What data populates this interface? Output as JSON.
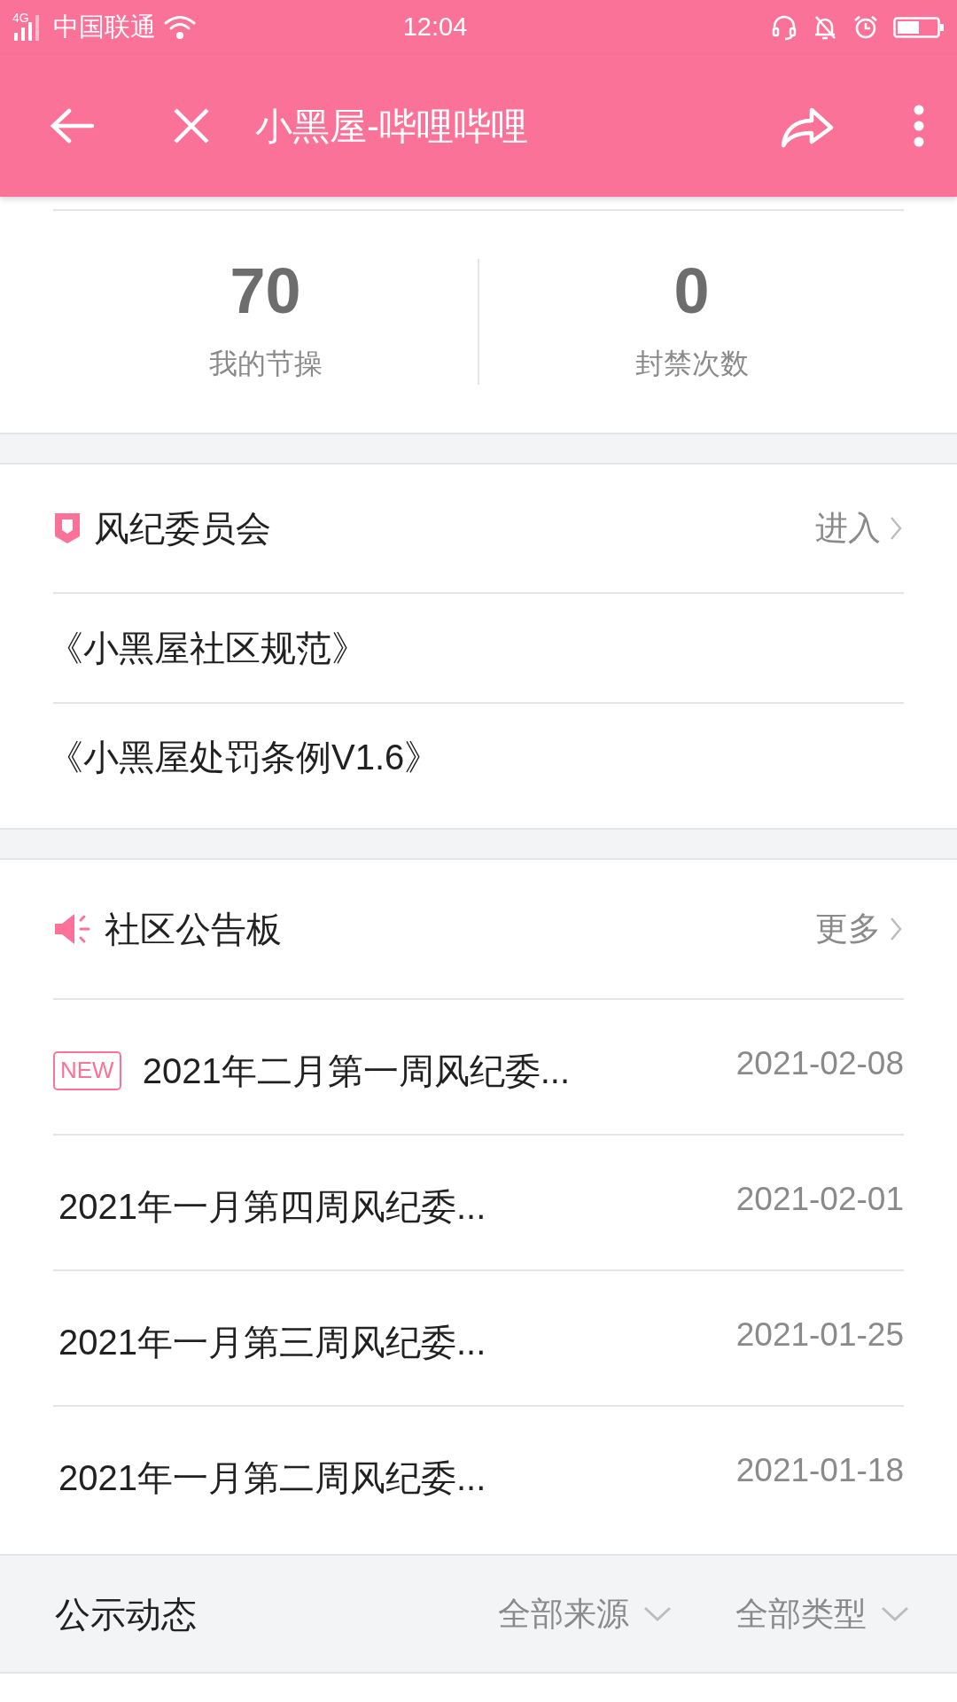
{
  "status_bar": {
    "network": "4G",
    "carrier": "中国联通",
    "time": "12:04"
  },
  "toolbar": {
    "title": "小黑屋-哔哩哔哩"
  },
  "stats": [
    {
      "value": "70",
      "label": "我的节操"
    },
    {
      "value": "0",
      "label": "封禁次数"
    }
  ],
  "committee": {
    "title": "风纪委员会",
    "action": "进入",
    "links": [
      "《小黑屋社区规范》",
      "《小黑屋处罚条例V1.6》"
    ]
  },
  "notices": {
    "title": "社区公告板",
    "action": "更多",
    "items": [
      {
        "badge": "NEW",
        "title": "2021年二月第一周风纪委...",
        "date": "2021-02-08"
      },
      {
        "title": "2021年一月第四周风纪委...",
        "date": "2021-02-01"
      },
      {
        "title": "2021年一月第三周风纪委...",
        "date": "2021-01-25"
      },
      {
        "title": "2021年一月第二周风纪委...",
        "date": "2021-01-18"
      }
    ]
  },
  "filter_bar": {
    "title": "公示动态",
    "filters": [
      "全部来源",
      "全部类型"
    ]
  }
}
